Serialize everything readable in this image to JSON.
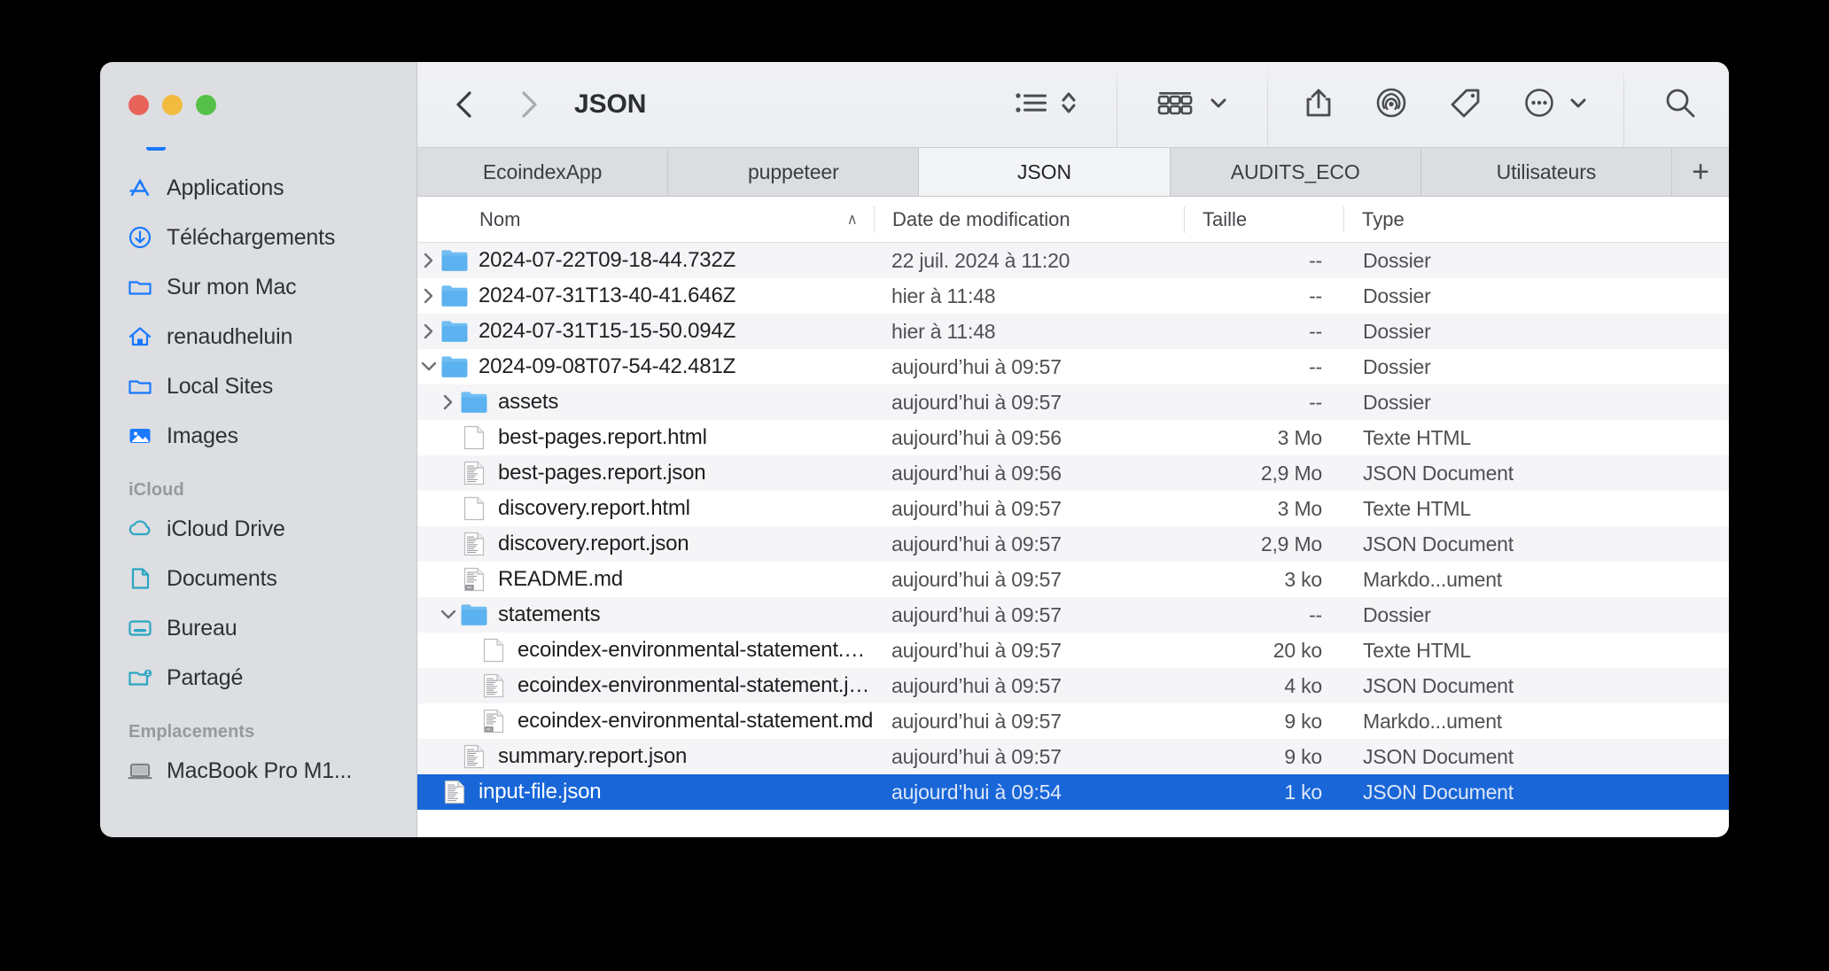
{
  "window": {
    "title": "JSON",
    "traffic_lights": [
      "close-button",
      "minimize-button",
      "maximize-button"
    ]
  },
  "toolbar": {
    "back_label": "‹",
    "forward_label": "›",
    "title": "JSON",
    "view_mode_icon": "list-view-icon",
    "view_sort_icon": "chevron-updown-icon",
    "group_icon": "group-items-icon",
    "group_chevron": "chevron-down-icon",
    "share_icon": "share-icon",
    "airdrop_icon": "airdrop-icon",
    "tag_icon": "tag-icon",
    "more_icon": "ellipsis-circle-icon",
    "more_chevron": "chevron-down-icon",
    "search_icon": "search-icon"
  },
  "sidebar": {
    "favorites": [
      {
        "label": "Applications",
        "icon": "applications-icon",
        "color": "#1a79ff"
      },
      {
        "label": "Téléchargements",
        "icon": "downloads-icon",
        "color": "#1a79ff"
      },
      {
        "label": "Sur mon Mac",
        "icon": "folder-icon",
        "color": "#1a79ff"
      },
      {
        "label": "renaudheluin",
        "icon": "home-icon",
        "color": "#1a79ff"
      },
      {
        "label": "Local Sites",
        "icon": "folder-icon",
        "color": "#1a79ff"
      },
      {
        "label": "Images",
        "icon": "photos-icon",
        "color": "#1a79ff"
      }
    ],
    "icloud_header": "iCloud",
    "icloud": [
      {
        "label": "iCloud Drive",
        "icon": "cloud-icon",
        "color": "#2ba6c4"
      },
      {
        "label": "Documents",
        "icon": "document-icon",
        "color": "#2ba6c4"
      },
      {
        "label": "Bureau",
        "icon": "desktop-icon",
        "color": "#2ba6c4"
      },
      {
        "label": "Partagé",
        "icon": "shared-folder-icon",
        "color": "#2ba6c4"
      }
    ],
    "locations_header": "Emplacements",
    "locations": [
      {
        "label": "MacBook Pro M1...",
        "icon": "laptop-icon",
        "color": "#7c7e82"
      }
    ]
  },
  "tabs": {
    "items": [
      {
        "label": "EcoindexApp",
        "active": false
      },
      {
        "label": "puppeteer",
        "active": false
      },
      {
        "label": "JSON",
        "active": true
      },
      {
        "label": "AUDITS_ECO",
        "active": false
      },
      {
        "label": "Utilisateurs",
        "active": false
      }
    ],
    "add_label": "+"
  },
  "columns": {
    "name": "Nom",
    "date": "Date de modification",
    "size": "Taille",
    "type": "Type",
    "sort_arrow": "∧"
  },
  "files": [
    {
      "name": "2024-07-22T09-18-44.732Z",
      "date": "22 juil. 2024 à 11:20",
      "size": "--",
      "type": "Dossier",
      "icon": "folder-icon",
      "indent": 0,
      "twisty": "collapsed",
      "selected": false
    },
    {
      "name": "2024-07-31T13-40-41.646Z",
      "date": "hier à 11:48",
      "size": "--",
      "type": "Dossier",
      "icon": "folder-icon",
      "indent": 0,
      "twisty": "collapsed",
      "selected": false
    },
    {
      "name": "2024-07-31T15-15-50.094Z",
      "date": "hier à 11:48",
      "size": "--",
      "type": "Dossier",
      "icon": "folder-icon",
      "indent": 0,
      "twisty": "collapsed",
      "selected": false
    },
    {
      "name": "2024-09-08T07-54-42.481Z",
      "date": "aujourd’hui à 09:57",
      "size": "--",
      "type": "Dossier",
      "icon": "folder-icon",
      "indent": 0,
      "twisty": "expanded",
      "selected": false
    },
    {
      "name": "assets",
      "date": "aujourd’hui à 09:57",
      "size": "--",
      "type": "Dossier",
      "icon": "folder-icon",
      "indent": 1,
      "twisty": "collapsed",
      "selected": false
    },
    {
      "name": "best-pages.report.html",
      "date": "aujourd’hui à 09:56",
      "size": "3 Mo",
      "type": "Texte HTML",
      "icon": "html-file-icon",
      "indent": 1,
      "twisty": "none",
      "selected": false
    },
    {
      "name": "best-pages.report.json",
      "date": "aujourd’hui à 09:56",
      "size": "2,9 Mo",
      "type": "JSON Document",
      "icon": "json-file-icon",
      "indent": 1,
      "twisty": "none",
      "selected": false
    },
    {
      "name": "discovery.report.html",
      "date": "aujourd’hui à 09:57",
      "size": "3 Mo",
      "type": "Texte HTML",
      "icon": "html-file-icon",
      "indent": 1,
      "twisty": "none",
      "selected": false
    },
    {
      "name": "discovery.report.json",
      "date": "aujourd’hui à 09:57",
      "size": "2,9 Mo",
      "type": "JSON Document",
      "icon": "json-file-icon",
      "indent": 1,
      "twisty": "none",
      "selected": false
    },
    {
      "name": "README.md",
      "date": "aujourd’hui à 09:57",
      "size": "3 ko",
      "type": "Markdo...ument",
      "icon": "markdown-file-icon",
      "indent": 1,
      "twisty": "none",
      "selected": false
    },
    {
      "name": "statements",
      "date": "aujourd’hui à 09:57",
      "size": "--",
      "type": "Dossier",
      "icon": "folder-icon",
      "indent": 1,
      "twisty": "expanded",
      "selected": false
    },
    {
      "name": "ecoindex-environmental-statement.html",
      "date": "aujourd’hui à 09:57",
      "size": "20 ko",
      "type": "Texte HTML",
      "icon": "html-file-icon",
      "indent": 2,
      "twisty": "none",
      "selected": false
    },
    {
      "name": "ecoindex-environmental-statement.json",
      "date": "aujourd’hui à 09:57",
      "size": "4 ko",
      "type": "JSON Document",
      "icon": "json-file-icon",
      "indent": 2,
      "twisty": "none",
      "selected": false
    },
    {
      "name": "ecoindex-environmental-statement.md",
      "date": "aujourd’hui à 09:57",
      "size": "9 ko",
      "type": "Markdo...ument",
      "icon": "markdown-file-icon",
      "indent": 2,
      "twisty": "none",
      "selected": false
    },
    {
      "name": "summary.report.json",
      "date": "aujourd’hui à 09:57",
      "size": "9 ko",
      "type": "JSON Document",
      "icon": "json-file-icon",
      "indent": 1,
      "twisty": "none",
      "selected": false
    },
    {
      "name": "input-file.json",
      "date": "aujourd’hui à 09:54",
      "size": "1 ko",
      "type": "JSON Document",
      "icon": "json-file-icon",
      "indent": 0,
      "twisty": "none",
      "selected": true
    }
  ],
  "colors": {
    "selection_blue": "#1866d8",
    "folder_blue": "#5ab0ef",
    "sidebar_blue": "#1a79ff",
    "icloud_teal": "#2ba6c4",
    "sidebar_bg": "#dcdee1"
  }
}
